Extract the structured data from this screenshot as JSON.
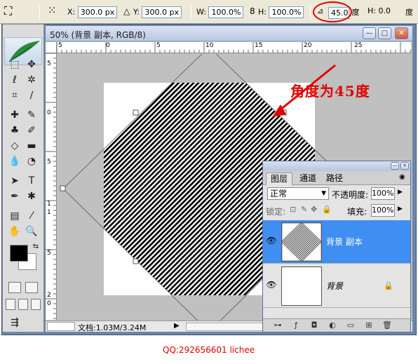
{
  "options_bar": {
    "x_label": "X:",
    "x_value": "300.0 px",
    "y_label": "Y:",
    "y_value": "300.0 px",
    "w_label": "W:",
    "w_value": "100.0%",
    "h_label": "H:",
    "h_value": "100.0%",
    "angle_value": "45.0",
    "angle_unit": "度",
    "hskew_label": "H:",
    "hskew_value": "0.0",
    "vskew_unit": "度"
  },
  "document": {
    "title": "50% (背景 副本, RGB/8)",
    "ruler_h": [
      "5",
      "0",
      "5",
      "10",
      "15",
      "20",
      "25"
    ],
    "ruler_v": [
      "5",
      "0",
      "5",
      "1",
      "1",
      "5",
      "2",
      "0"
    ],
    "status": "文档:1.03M/3.24M",
    "status_arrow": "▶"
  },
  "annotation": "角度为45度",
  "layers_panel": {
    "tabs": [
      "图层",
      "通道",
      "路径"
    ],
    "blend_mode": "正常",
    "opacity_label": "不透明度:",
    "opacity_value": "100%",
    "lock_label": "锁定:",
    "fill_label": "填充:",
    "fill_value": "100%",
    "layers": [
      {
        "name": "背景 副本",
        "selected": true
      },
      {
        "name": "背景",
        "selected": false
      }
    ]
  },
  "watermark": "QQ:292656601 lichee",
  "colors": {
    "accent_red": "#e00000",
    "selection_blue": "#3f8ef2",
    "workspace_gray": "#c0c0c0"
  }
}
